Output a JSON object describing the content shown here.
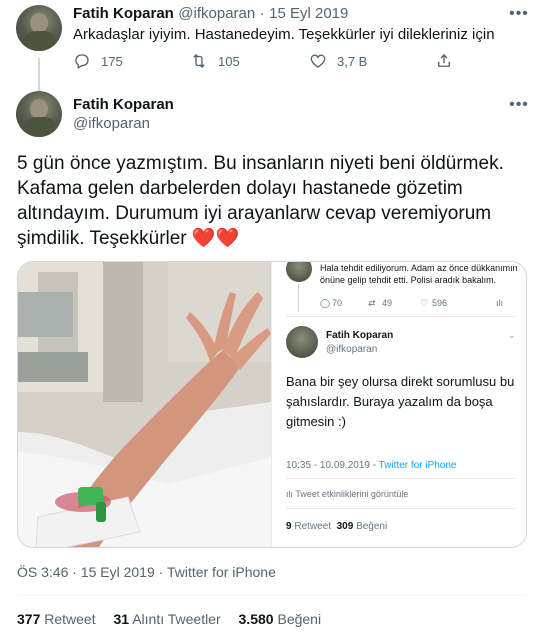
{
  "first_tweet": {
    "name": "Fatih Koparan",
    "handle": "@ifkoparan",
    "separator": "·",
    "date": "15 Eyl 2019",
    "text": "Arkadaşlar iyiyim. Hastanedeyim. Teşekkürler iyi dilekleriniz için",
    "reply_count": "175",
    "retweet_count": "105",
    "like_count": "3,7 B"
  },
  "main_tweet": {
    "name": "Fatih Koparan",
    "handle": "@ifkoparan",
    "text": "5 gün önce yazmıştım. Bu insanların niyeti beni öldürmek. Kafama gelen darbelerden dolayı hastanede gözetim altındayım. Durumum iyi arayanlarw cevap veremiyorum şimdilik. Teşekkürler",
    "emoji": "❤️❤️",
    "timestamp": "ÖS 3:46 · 15 Eyl 2019 · Twitter for iPhone",
    "stats": {
      "retweets": "377",
      "retweets_label": "Retweet",
      "quotes": "31",
      "quotes_label": "Alıntı Tweetler",
      "likes": "3.580",
      "likes_label": "Beğeni"
    }
  },
  "screenshot": {
    "top_text": "Hala tehdit ediliyorum. Adam az önce dükkanımın önüne gelip tehdit etti. Polisi aradık bakalım.",
    "top_replies": "70",
    "top_retweets": "49",
    "top_likes": "596",
    "name": "Fatih Koparan",
    "handle": "@ifkoparan",
    "body": "Bana bir şey olursa direkt sorumlusu bu şahıslardır. Buraya yazalım da boşa gitmesin :)",
    "time": "10:35 - 10.09.2019 - ",
    "source": "Twitter for iPhone",
    "activity": "Tweet etkinliklerini görüntüle",
    "retweets": "9",
    "retweets_label": "Retweet",
    "likes": "309",
    "likes_label": "Beğeni"
  },
  "icons": {
    "reply": "reply-icon",
    "retweet": "retweet-icon",
    "like": "heart-icon",
    "share": "share-icon",
    "more": "more-icon"
  },
  "colors": {
    "text": "#0f1419",
    "muted": "#536471",
    "heart": "#e0245e",
    "link": "#1da1f2",
    "border": "#cfd9de"
  }
}
